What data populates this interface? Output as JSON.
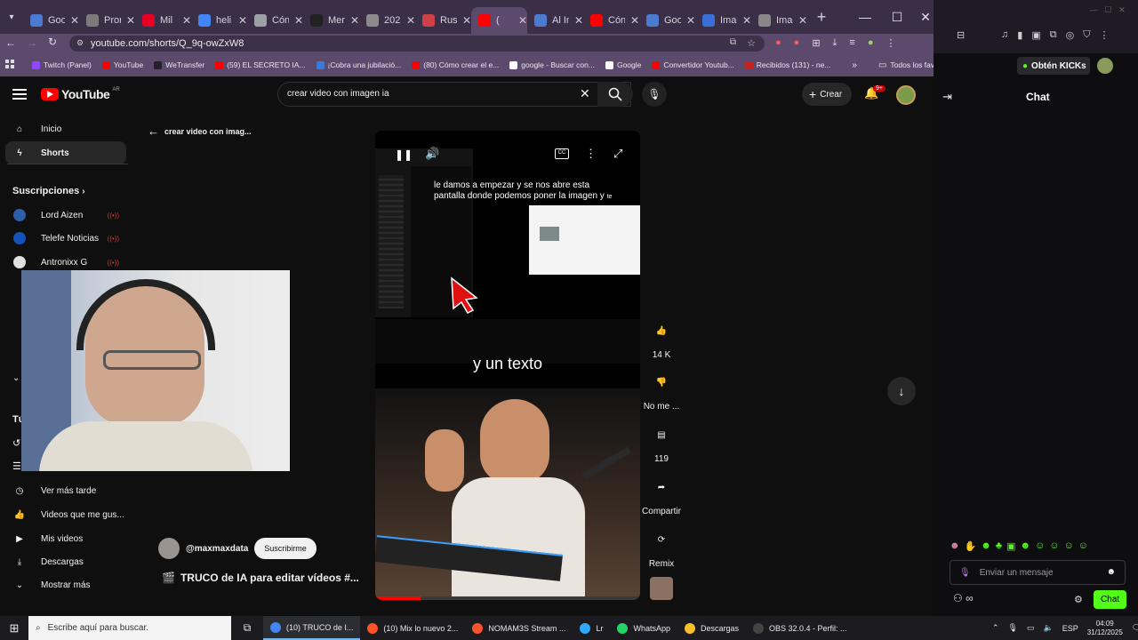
{
  "browser": {
    "tabs": [
      {
        "label": "Goo",
        "color": "#4a7bd0"
      },
      {
        "label": "Pron",
        "color": "#7a7a7a"
      },
      {
        "label": "Mil",
        "color": "#e60023"
      },
      {
        "label": "heli",
        "color": "#4285f4"
      },
      {
        "label": "Cón",
        "color": "#9aa0a6"
      },
      {
        "label": "Mer",
        "color": "#222222"
      },
      {
        "label": "202",
        "color": "#8a8a8a"
      },
      {
        "label": "Rus",
        "color": "#d0404b"
      },
      {
        "label": "(",
        "color": "#ff0000"
      },
      {
        "label": "Al In",
        "color": "#4a7bd0"
      },
      {
        "label": "Cón",
        "color": "#ff0000"
      },
      {
        "label": "Goo",
        "color": "#4a7bd0"
      },
      {
        "label": "Imag",
        "color": "#3a6fd8"
      },
      {
        "label": "Imag",
        "color": "#888888"
      }
    ],
    "url": "youtube.com/shorts/Q_9q-owZxW8",
    "bookmarks": [
      {
        "label": "Twitch (Panel)",
        "color": "#9146ff"
      },
      {
        "label": "YouTube",
        "color": "#ff0000"
      },
      {
        "label": "WeTransfer",
        "color": "#222222"
      },
      {
        "label": "(59) EL SECRETO IA...",
        "color": "#ff0000"
      },
      {
        "label": "¡Cobra una jubilació...",
        "color": "#3a7bd5"
      },
      {
        "label": "(80) Cómo crear el e...",
        "color": "#ff0000"
      },
      {
        "label": "google - Buscar con...",
        "color": "#ffffff"
      },
      {
        "label": "Google",
        "color": "#ffffff"
      },
      {
        "label": "Convertidor Youtub...",
        "color": "#ff0000"
      },
      {
        "label": "Recibidos (131) - ne...",
        "color": "#c5221f"
      }
    ],
    "all_bookmarks": "Todos los favoritos"
  },
  "youtube": {
    "logo": "YouTube",
    "country": "AR",
    "search_value": "crear video con imagen ia",
    "create_label": "Crear",
    "notif_badge": "9+",
    "back_label": "crear video con imag...",
    "nav": {
      "inicio": "Inicio",
      "shorts": "Shorts",
      "subs_header": "Suscripciones",
      "subs": [
        {
          "label": "Lord Aizen",
          "color": "#2d5fa8"
        },
        {
          "label": "Telefe Noticias",
          "color": "#1452b8"
        },
        {
          "label": "Antronixx G",
          "color": "#e0e0e0"
        }
      ],
      "tu_header": "Tú",
      "ver_mas_tarde": "Ver más tarde",
      "videos_gustan": "Videos que me gus...",
      "mis_videos": "Mis videos",
      "descargas": "Descargas",
      "mostrar_mas": "Mostrar más"
    },
    "video": {
      "overlay_caption": "le damos a empezar y se nos abre esta pantalla donde podemos poner la imagen y",
      "caption_suffix": "te",
      "subtitle": "y un texto",
      "channel": "@maxmaxdata",
      "subscribe": "Suscribirme",
      "title": "TRUCO de IA para editar vídeos #...",
      "progress": 0.17
    },
    "actions": {
      "likes": "14 K",
      "dislike": "No me ...",
      "comments": "119",
      "share": "Compartir",
      "remix": "Remix"
    }
  },
  "side_panel": {
    "kicks": "Obtén KICKs",
    "chat_title": "Chat",
    "message_placeholder": "Enviar un mensaje",
    "chat_button": "Chat"
  },
  "taskbar": {
    "search_placeholder": "Escribe aquí para buscar.",
    "items": [
      {
        "label": "(10) TRUCO de I...",
        "color": "#4285f4"
      },
      {
        "label": "(10) Mix lo nuevo 2...",
        "color": "#fb542b"
      },
      {
        "label": "NOMAM3S Stream ...",
        "color": "#fb542b"
      },
      {
        "label": "Lr",
        "color": "#31a8ff"
      },
      {
        "label": "WhatsApp",
        "color": "#25d366"
      },
      {
        "label": "Descargas",
        "color": "#f8c12c"
      },
      {
        "label": "OBS 32.0.4 - Perfil: ...",
        "color": "#444444"
      }
    ],
    "lang": "ESP",
    "time": "04:09",
    "date": "31/12/2025"
  }
}
